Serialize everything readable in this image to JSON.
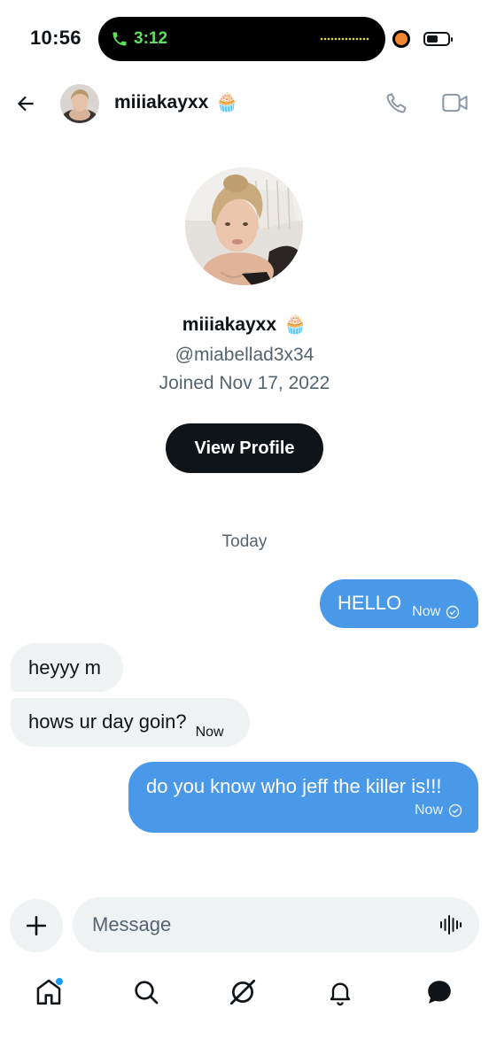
{
  "status_bar": {
    "time": "10:56",
    "call_timer": "3:12"
  },
  "header": {
    "name": "miiiakayxx",
    "emoji": "🧁"
  },
  "profile": {
    "name": "miiiakayxx",
    "emoji": "🧁",
    "handle": "@miabellad3x34",
    "joined": "Joined Nov 17, 2022",
    "view_profile_label": "View Profile"
  },
  "conversation": {
    "day_label": "Today",
    "messages": [
      {
        "direction": "outgoing",
        "text": "HELLO",
        "time": "Now",
        "status": "sent"
      },
      {
        "direction": "incoming",
        "text": "heyyy m",
        "time": ""
      },
      {
        "direction": "incoming",
        "text": "hows ur day goin?",
        "time": "Now"
      },
      {
        "direction": "outgoing",
        "text": "do you know who jeff the killer is!!!",
        "time": "Now",
        "status": "sent"
      }
    ]
  },
  "composer": {
    "placeholder": "Message"
  },
  "tabs": [
    "home-icon",
    "search-icon",
    "grok-icon",
    "bell-icon",
    "messages-icon"
  ],
  "colors": {
    "outgoing_bubble": "#4a99e9",
    "incoming_bubble": "#eff3f4",
    "call_green": "#5ee05a",
    "text_primary": "#0f1419",
    "text_secondary": "#536471",
    "notification_dot": "#1d9bf0"
  }
}
